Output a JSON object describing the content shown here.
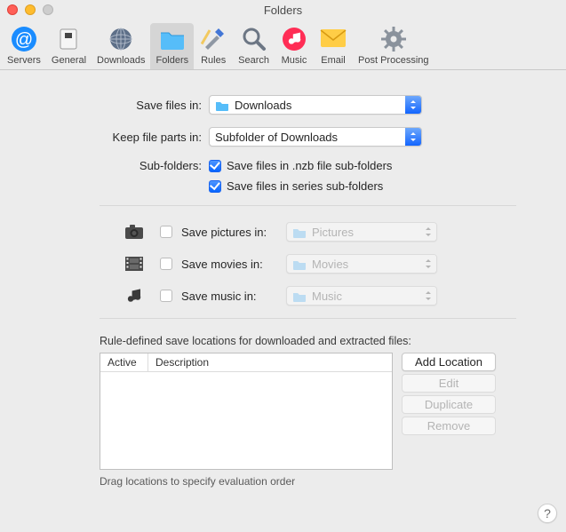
{
  "window": {
    "title": "Folders"
  },
  "toolbar": {
    "items": [
      {
        "label": "Servers"
      },
      {
        "label": "General"
      },
      {
        "label": "Downloads"
      },
      {
        "label": "Folders"
      },
      {
        "label": "Rules"
      },
      {
        "label": "Search"
      },
      {
        "label": "Music"
      },
      {
        "label": "Email"
      },
      {
        "label": "Post Processing"
      }
    ]
  },
  "form": {
    "save_files_label": "Save files in:",
    "save_files_value": "Downloads",
    "keep_parts_label": "Keep file parts in:",
    "keep_parts_value": "Subfolder of Downloads",
    "sub_folders_label": "Sub-folders:",
    "cb_nzb_label": "Save files in .nzb file sub-folders",
    "cb_series_label": "Save files in series sub-folders",
    "pictures_label": "Save pictures in:",
    "pictures_value": "Pictures",
    "movies_label": "Save movies in:",
    "movies_value": "Movies",
    "music_label": "Save music in:",
    "music_value": "Music"
  },
  "rules": {
    "caption": "Rule-defined save locations for downloaded and extracted files:",
    "col_active": "Active",
    "col_description": "Description",
    "btn_add": "Add Location",
    "btn_edit": "Edit",
    "btn_dup": "Duplicate",
    "btn_remove": "Remove",
    "hint": "Drag locations to specify evaluation order"
  },
  "help": "?"
}
